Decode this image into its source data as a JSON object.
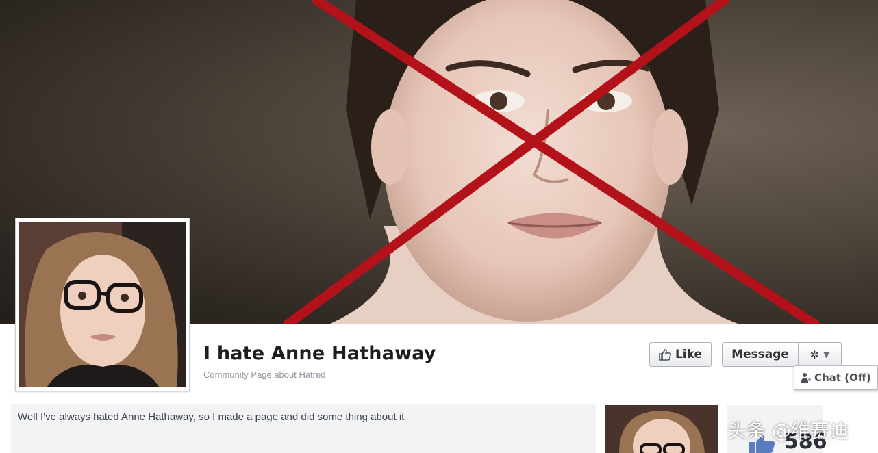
{
  "page": {
    "name": "I hate Anne Hathaway",
    "category": "Community Page about Hatred"
  },
  "actions": {
    "like_label": "Like",
    "message_label": "Message",
    "chat_label": "Chat (Off)"
  },
  "about": {
    "text": "Well I've always hated Anne Hathaway, so I made a page and did some thing about it"
  },
  "stats": {
    "like_count": "586"
  },
  "overlay": {
    "watermark": "头条 @维赛迪"
  },
  "colors": {
    "cross": "#b3121a",
    "cover_bg": "#4b4239",
    "panel_bg": "#f2f3f5"
  }
}
